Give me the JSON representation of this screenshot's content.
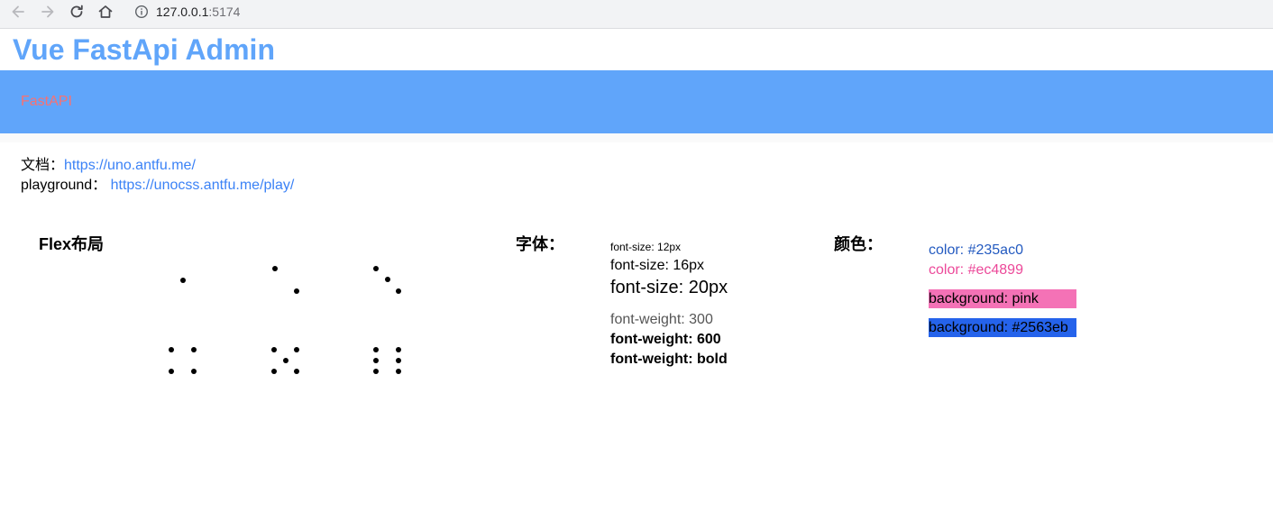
{
  "browser": {
    "url_host": "127.0.0.1",
    "url_port": ":5174"
  },
  "header": {
    "title": "Vue FastApi Admin",
    "bar_text": "FastAPI"
  },
  "docs": {
    "doc_label": "文档：",
    "doc_url": "https://uno.antfu.me/",
    "playground_label": "playground：",
    "playground_url": "https://unocss.antfu.me/play/"
  },
  "flex_section": {
    "title": "Flex布局",
    "dice_faces": [
      1,
      2,
      3,
      4,
      5,
      6
    ]
  },
  "font_section": {
    "title": "字体：",
    "samples": [
      "font-size: 12px",
      "font-size: 16px",
      "font-size: 20px",
      "font-weight: 300",
      "font-weight: 600",
      "font-weight: bold"
    ]
  },
  "color_section": {
    "title": "颜色：",
    "color_samples": [
      "color: #235ac0",
      "color: #ec4899"
    ],
    "background_samples": [
      "background: pink",
      "background: #2563eb"
    ]
  },
  "colors": {
    "primary": "#60a5fa",
    "bar_text": "#f87171",
    "link": "#3b82f6",
    "color_1": "#235ac0",
    "color_2": "#ec4899",
    "bg_pink": "#f472b6",
    "bg_blue": "#2563eb"
  }
}
